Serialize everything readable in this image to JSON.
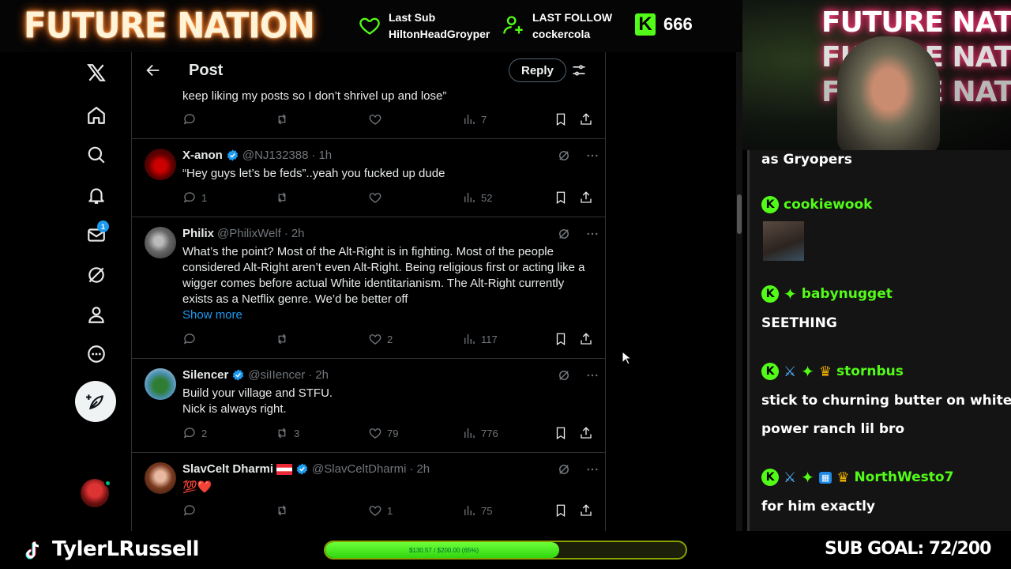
{
  "overlay": {
    "brand": "FUTURE NATION",
    "last_sub_label": "Last Sub",
    "last_sub_value": "HiltonHeadGroyper",
    "last_follow_label": "LAST FOLLOW",
    "last_follow_value": "cockercola",
    "kick_count": "666",
    "kick_letter": "K"
  },
  "nav": {
    "messages_badge": "1"
  },
  "header": {
    "title": "Post",
    "reply_label": "Reply"
  },
  "tweets": [
    {
      "text": "keep liking my posts so I don’t shrivel up and lose”",
      "views": "7"
    },
    {
      "name": "X-anon",
      "handle": "@NJ132388",
      "time": "1h",
      "text": "“Hey guys let’s be feds”..yeah you fucked up dude",
      "replies": "1",
      "reposts": "",
      "likes": "",
      "views": "52"
    },
    {
      "name": "Philix",
      "handle": "@PhilixWelf",
      "time": "2h",
      "text": "What’s the point? Most of the Alt-Right is in fighting. Most of the people considered Alt-Right aren’t even Alt-Right. Being religious first or acting like a wigger comes before actual White identitarianism. The Alt-Right currently exists as a Netflix genre. We’d be better off",
      "show_more": "Show more",
      "replies": "",
      "reposts": "",
      "likes": "2",
      "views": "117"
    },
    {
      "name": "Silencer",
      "handle": "@siIIencer",
      "time": "2h",
      "text_line1": "Build your village and STFU.",
      "text_line2": "Nick is always right.",
      "replies": "2",
      "reposts": "3",
      "likes": "79",
      "views": "776"
    },
    {
      "name": "SlavCelt Dharmi",
      "handle": "@SlavCeltDharmi",
      "time": "2h",
      "text": "💯❤️",
      "replies": "",
      "reposts": "",
      "likes": "1",
      "views": "75"
    }
  ],
  "chat": {
    "messages": [
      {
        "text": "as Gryopers"
      },
      {
        "user": "cookiewook"
      },
      {
        "user": "babynugget",
        "text": "SEETHING"
      },
      {
        "user": "stornbus",
        "text_line1": "stick to churning butter on white",
        "text_line2": "power ranch lil bro"
      },
      {
        "user": "NorthWesto7",
        "text": "for him exactly"
      }
    ]
  },
  "footer": {
    "tiktok_name": "TylerLRussell",
    "goal_text": "$130.57 / $200.00 (65%)",
    "goal_percent": 65,
    "sub_goal": "SUB GOAL: 72/200"
  },
  "colors": {
    "kick_green": "#53fc18",
    "x_blue": "#1d9bf0",
    "text_secondary": "#71767b"
  }
}
